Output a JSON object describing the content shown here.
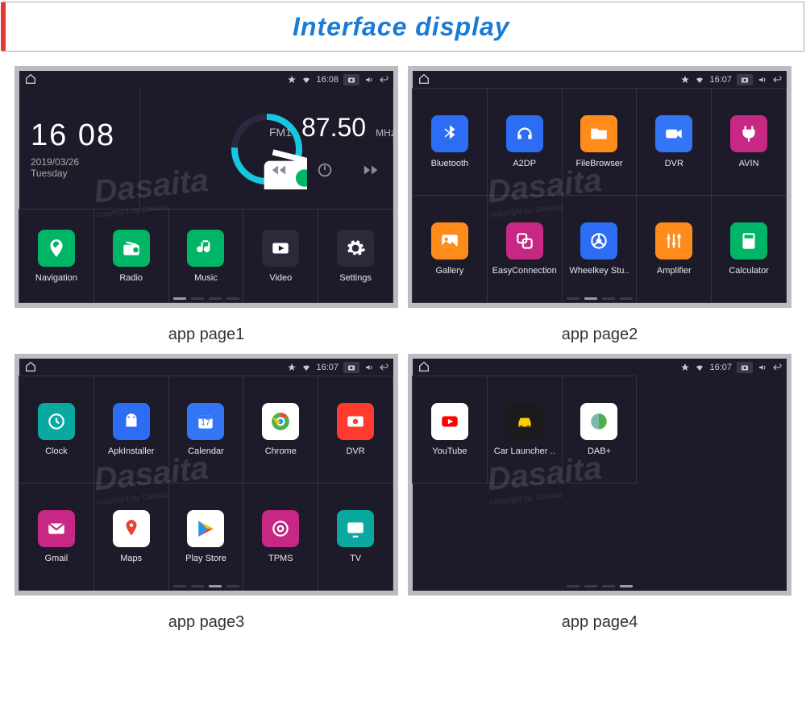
{
  "header": {
    "title": "Interface display"
  },
  "watermark": {
    "brand": "Dasaita",
    "sub": "copyright by Dasaita"
  },
  "statusbar_common": {
    "camera": "camera",
    "volume": "volume",
    "back": "back",
    "wifi": "wifi",
    "location": "location"
  },
  "panels": [
    {
      "caption": "app page1",
      "time_status": "16:08",
      "clock": {
        "time": "16 08",
        "date": "2019/03/26",
        "day": "Tuesday"
      },
      "radio": {
        "band": "FM1",
        "freq": "87.50",
        "unit": "MHz"
      },
      "tiles": [
        {
          "name": "navigation",
          "label": "Navigation",
          "color": "#00b566",
          "icon": "pin"
        },
        {
          "name": "radio",
          "label": "Radio",
          "color": "#00b566",
          "icon": "radio"
        },
        {
          "name": "music",
          "label": "Music",
          "color": "#00b566",
          "icon": "music"
        },
        {
          "name": "video",
          "label": "Video",
          "color": "#2a2a3b",
          "icon": "video"
        },
        {
          "name": "settings",
          "label": "Settings",
          "color": "#2a2a3b",
          "icon": "gear"
        }
      ],
      "active_dot": 0
    },
    {
      "caption": "app page2",
      "time_status": "16:07",
      "tiles": [
        {
          "name": "bluetooth",
          "label": "Bluetooth",
          "color": "#2d6df4",
          "icon": "bluetooth"
        },
        {
          "name": "a2dp",
          "label": "A2DP",
          "color": "#2d6df4",
          "icon": "headset"
        },
        {
          "name": "filebrowser",
          "label": "FileBrowser",
          "color": "#ff8c1a",
          "icon": "folder"
        },
        {
          "name": "dvr",
          "label": "DVR",
          "color": "#3475f5",
          "icon": "cam"
        },
        {
          "name": "avin",
          "label": "AVIN",
          "color": "#c62883",
          "icon": "plug"
        },
        {
          "name": "gallery",
          "label": "Gallery",
          "color": "#ff8c1a",
          "icon": "image"
        },
        {
          "name": "easyconn",
          "label": "EasyConnection",
          "color": "#c62883",
          "icon": "link"
        },
        {
          "name": "wheelkey",
          "label": "Wheelkey Stu..",
          "color": "#2d6df4",
          "icon": "wheel"
        },
        {
          "name": "amplifier",
          "label": "Amplifier",
          "color": "#ff8c1a",
          "icon": "sliders"
        },
        {
          "name": "calculator",
          "label": "Calculator",
          "color": "#00b566",
          "icon": "calc"
        }
      ],
      "active_dot": 1
    },
    {
      "caption": "app page3",
      "time_status": "16:07",
      "tiles": [
        {
          "name": "clock",
          "label": "Clock",
          "color": "#0aa9a0",
          "icon": "clock"
        },
        {
          "name": "apkinstall",
          "label": "ApkInstaller",
          "color": "#2d6df4",
          "icon": "android"
        },
        {
          "name": "calendar",
          "label": "Calendar",
          "color": "#3475f5",
          "icon": "calendar",
          "badge": "17"
        },
        {
          "name": "chrome",
          "label": "Chrome",
          "color": "#ffffff",
          "icon": "chrome"
        },
        {
          "name": "dvr2",
          "label": "DVR",
          "color": "#ff3b30",
          "icon": "rec"
        },
        {
          "name": "gmail",
          "label": "Gmail",
          "color": "#c62883",
          "icon": "mail"
        },
        {
          "name": "maps",
          "label": "Maps",
          "color": "#ffffff",
          "icon": "maps"
        },
        {
          "name": "playstore",
          "label": "Play Store",
          "color": "#ffffff",
          "icon": "play"
        },
        {
          "name": "tpms",
          "label": "TPMS",
          "color": "#c62883",
          "icon": "tire"
        },
        {
          "name": "tv",
          "label": "TV",
          "color": "#0aa9a0",
          "icon": "tv"
        }
      ],
      "active_dot": 2
    },
    {
      "caption": "app page4",
      "time_status": "16:07",
      "tiles": [
        {
          "name": "youtube",
          "label": "YouTube",
          "color": "#ffffff",
          "icon": "youtube"
        },
        {
          "name": "carlauncher",
          "label": "Car Launcher ..",
          "color": "#1b1b1b",
          "icon": "car"
        },
        {
          "name": "dabplus",
          "label": "DAB+",
          "color": "#ffffff",
          "icon": "dab"
        }
      ],
      "active_dot": 3
    }
  ]
}
